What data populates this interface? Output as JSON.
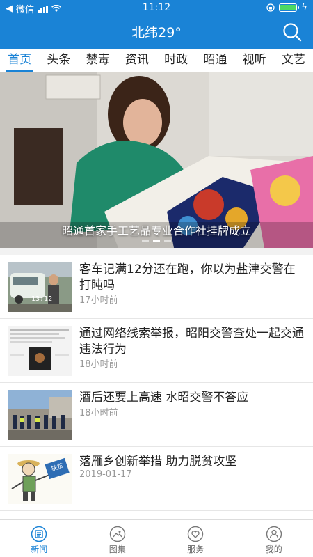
{
  "status_bar": {
    "carrier": "微信",
    "time": "11:12"
  },
  "header": {
    "title": "北纬29°"
  },
  "tabs": [
    {
      "label": "首页",
      "active": true
    },
    {
      "label": "头条"
    },
    {
      "label": "禁毒"
    },
    {
      "label": "资讯"
    },
    {
      "label": "时政"
    },
    {
      "label": "昭通"
    },
    {
      "label": "视听"
    },
    {
      "label": "文艺"
    }
  ],
  "banner": {
    "caption": "昭通首家手工艺品专业合作社挂牌成立",
    "slide_count": 3,
    "active_slide": 2
  },
  "news": [
    {
      "title": "客车记满12分还在跑，你以为盐津交警在打盹吗",
      "meta": "17小时前",
      "thumb_text": "13:12"
    },
    {
      "title": "通过网络线索举报，昭阳交警查处一起交通违法行为",
      "meta": "18小时前"
    },
    {
      "title": "酒后还要上高速 水昭交警不答应",
      "meta": "18小时前"
    },
    {
      "title": "落雁乡创新举措 助力脱贫攻坚",
      "meta": "2019-01-17",
      "thumb_text": "扶贫"
    }
  ],
  "bottom_nav": [
    {
      "label": "新闻",
      "icon": "news-icon",
      "active": true
    },
    {
      "label": "图集",
      "icon": "gallery-icon"
    },
    {
      "label": "服务",
      "icon": "heart-service-icon"
    },
    {
      "label": "我的",
      "icon": "user-icon"
    }
  ],
  "colors": {
    "brand": "#1a83d6",
    "meta_text": "#999999"
  }
}
